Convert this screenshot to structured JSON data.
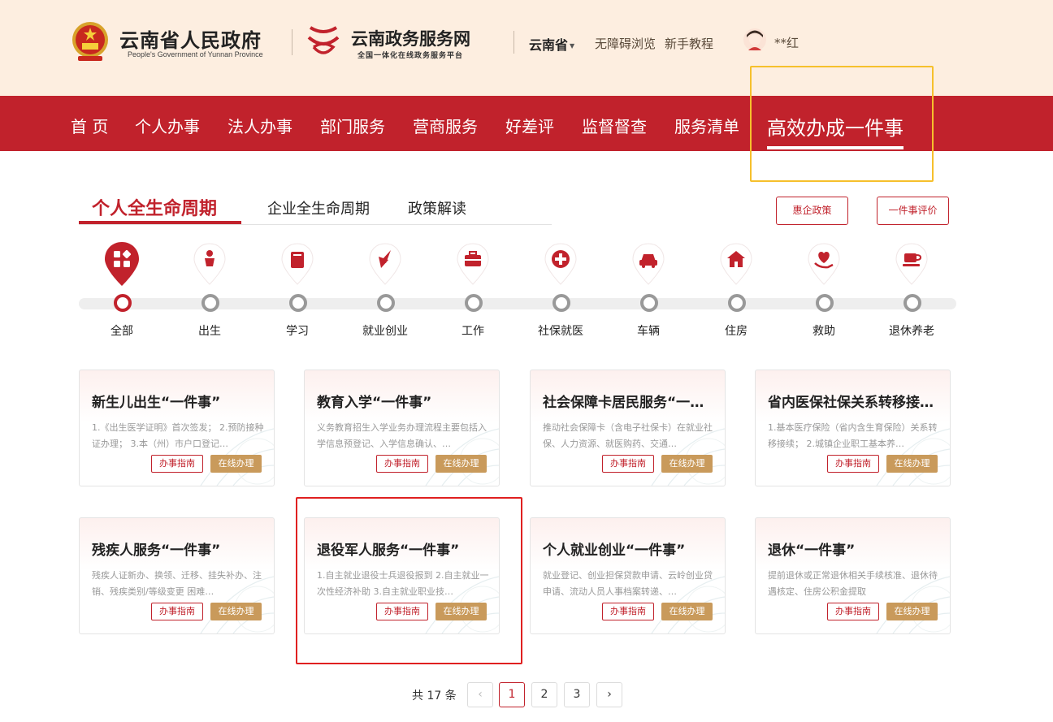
{
  "header": {
    "gov_title": "云南省人民政府",
    "gov_subtitle": "People's Government of Yunnan Province",
    "service_title": "云南政务服务网",
    "service_subtitle": "全国一体化在线政务服务平台",
    "region": "云南省",
    "links": [
      "无障碍浏览",
      "新手教程"
    ],
    "username": "**红"
  },
  "nav": {
    "items": [
      "首 页",
      "个人办事",
      "法人办事",
      "部门服务",
      "营商服务",
      "好差评",
      "监督督查",
      "服务清单",
      "高效办成一件事"
    ],
    "active_index": 8
  },
  "tabs": {
    "items": [
      "个人全生命周期",
      "企业全生命周期",
      "政策解读"
    ],
    "active_index": 0
  },
  "buttons": {
    "policy": "惠企政策",
    "evaluation": "一件事评价"
  },
  "categories": [
    {
      "label": "全部",
      "icon": "grid-icon",
      "active": true
    },
    {
      "label": "出生",
      "icon": "baby-icon"
    },
    {
      "label": "学习",
      "icon": "book-icon"
    },
    {
      "label": "就业创业",
      "icon": "rocket-icon"
    },
    {
      "label": "工作",
      "icon": "briefcase-icon"
    },
    {
      "label": "社保就医",
      "icon": "medical-cross-icon"
    },
    {
      "label": "车辆",
      "icon": "car-icon"
    },
    {
      "label": "住房",
      "icon": "house-icon"
    },
    {
      "label": "救助",
      "icon": "heart-hand-icon"
    },
    {
      "label": "退休养老",
      "icon": "tea-cup-icon"
    }
  ],
  "cards": [
    {
      "title": "新生儿出生“一件事”",
      "desc": "1.《出生医学证明》首次签发； 2.预防接种证办理； 3.本（州）市户口登记…"
    },
    {
      "title": "教育入学“一件事”",
      "desc": "义务教育招生入学业务办理流程主要包括入学信息预登记、入学信息确认、…"
    },
    {
      "title": "社会保障卡居民服务“一件…",
      "desc": "推动社会保障卡（含电子社保卡）在就业社保、人力资源、就医购药、交通…"
    },
    {
      "title": "省内医保社保关系转移接续…",
      "desc": "1.基本医疗保险（省内含生育保险）关系转移接续； 2.城镇企业职工基本养…"
    },
    {
      "title": "残疾人服务“一件事”",
      "desc": "残疾人证新办、换领、迁移、挂失补办、注销、残疾类别/等级变更 困难…"
    },
    {
      "title": "退役军人服务“一件事”",
      "desc": "1.自主就业退役士兵退役报到 2.自主就业一次性经济补助 3.自主就业职业技…"
    },
    {
      "title": "个人就业创业“一件事”",
      "desc": "就业登记、创业担保贷款申请、云岭创业贷申请、流动人员人事档案转递、…"
    },
    {
      "title": "退休“一件事”",
      "desc": "提前退休或正常退休相关手续核准、退休待遇核定、住房公积金提取"
    }
  ],
  "card_buttons": {
    "guide": "办事指南",
    "online": "在线办理"
  },
  "pagination": {
    "total": "共 17 条",
    "pages": [
      "1",
      "2",
      "3"
    ],
    "current": "1",
    "prev": "‹",
    "next": "›"
  },
  "colors": {
    "primary_red": "#c1222c",
    "header_bg": "#fdeee0",
    "gold": "#c99a5b",
    "highlight_yellow": "#f6c02c",
    "highlight_red": "#e02020"
  }
}
